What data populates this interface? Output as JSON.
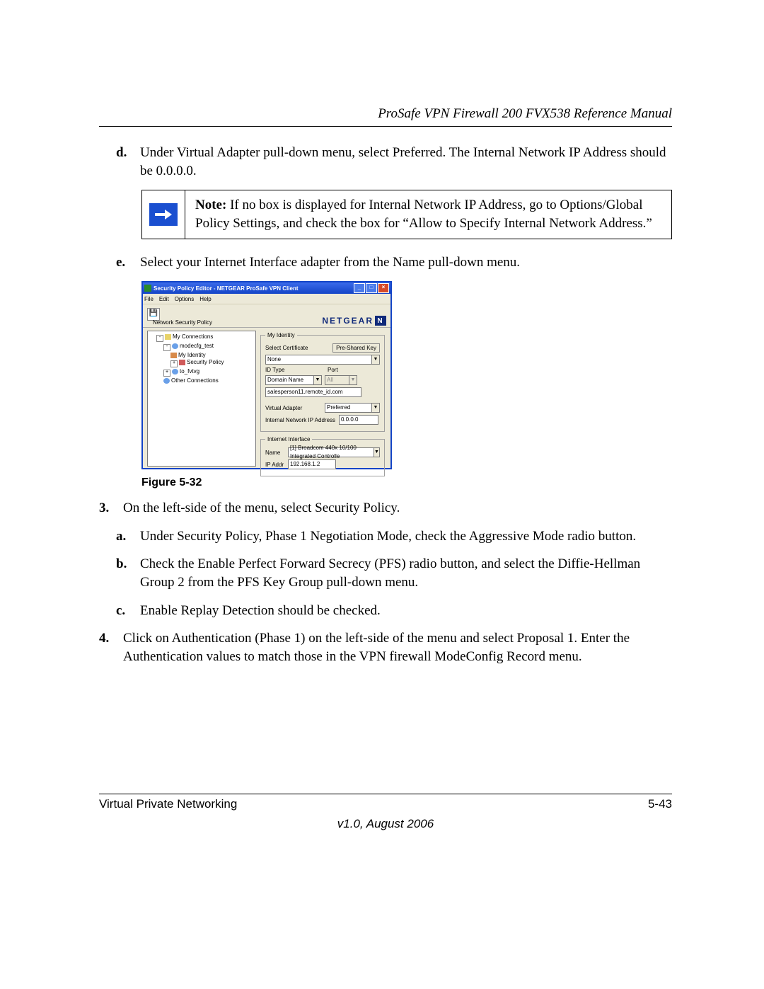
{
  "header": {
    "title": "ProSafe VPN Firewall 200 FVX538 Reference Manual"
  },
  "step_d": {
    "marker": "d.",
    "text": "Under Virtual Adapter pull-down menu, select Preferred. The Internal Network IP Address should be 0.0.0.0."
  },
  "note": {
    "label": "Note:",
    "text": " If no box is displayed for Internal Network IP Address, go to Options/Global Policy Settings, and check the box for “Allow to Specify Internal Network Address.”"
  },
  "step_e": {
    "marker": "e.",
    "text": "Select your Internet Interface adapter from the Name pull-down menu."
  },
  "app": {
    "title": "Security Policy Editor - NETGEAR ProSafe VPN Client",
    "menubar": [
      "File",
      "Edit",
      "Options",
      "Help"
    ],
    "logo": "NETGEAR",
    "nsp_label": "Network Security Policy",
    "tree": {
      "root": "My Connections",
      "conn1": "modecfg_test",
      "conn1_id": "My Identity",
      "conn1_sp": "Security Policy",
      "conn2": "to_fvtvg",
      "other": "Other Connections"
    },
    "form": {
      "identity_legend": "My Identity",
      "select_cert": "Select Certificate",
      "psk_btn": "Pre-Shared Key",
      "cert_value": "None",
      "id_type": "ID Type",
      "port_label": "Port",
      "id_type_value": "Domain Name",
      "port_value": "All",
      "domain_value": "salesperson11.remote_id.com",
      "va_label": "Virtual Adapter",
      "va_value": "Preferred",
      "inip_label": "Internal Network IP Address",
      "inip_value": "0.0.0.0",
      "ii_legend": "Internet Interface",
      "ii_name_label": "Name",
      "ii_name_value": "[1] Broadcom 440x 10/100 Integrated Controlle",
      "ii_ip_label": "IP Addr",
      "ii_ip_value": "192.168.1.2"
    }
  },
  "figure_caption": "Figure 5-32",
  "step_3": {
    "marker": "3.",
    "text": "On the left-side of the menu, select Security Policy.",
    "a": {
      "marker": "a.",
      "text": "Under Security Policy, Phase 1 Negotiation Mode, check the Aggressive Mode radio button."
    },
    "b": {
      "marker": "b.",
      "text": "Check the Enable Perfect Forward Secrecy (PFS) radio button, and select the Diffie-Hellman Group 2 from the PFS Key Group pull-down menu."
    },
    "c": {
      "marker": "c.",
      "text": "Enable Replay Detection should be checked."
    }
  },
  "step_4": {
    "marker": "4.",
    "text": "Click on Authentication (Phase 1) on the left-side of the menu and select Proposal 1. Enter the Authentication values to match those in the VPN firewall ModeConfig Record menu."
  },
  "footer": {
    "left": "Virtual Private Networking",
    "right": "5-43",
    "version": "v1.0, August 2006"
  }
}
